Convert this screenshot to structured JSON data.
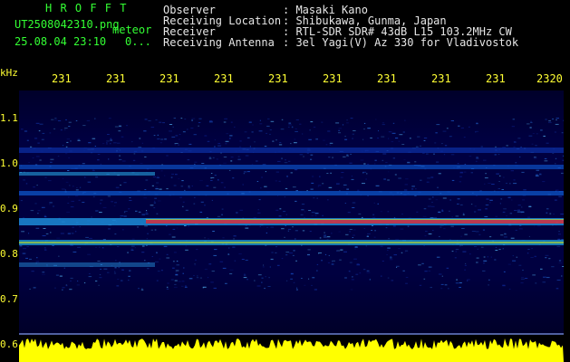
{
  "header": {
    "app_name": "H R O F F T",
    "filename": "UT2508042310.png",
    "tag": "meteor",
    "timestamp": "25.08.04 23:10",
    "count": "0..."
  },
  "info": {
    "labels": [
      "Observer",
      "Receiving Location",
      "Receiver",
      "Receiving Antenna"
    ],
    "values": [
      ": Masaki Kano",
      ": Shibukawa, Gunma, Japan",
      ": RTL-SDR SDR# 43dB L15 103.2MHz CW",
      ": 3el Yagi(V) Az 330 for Vladivostok"
    ]
  },
  "axis": {
    "y_unit": "kHz",
    "y_ticks": [
      "1.1",
      "1.0",
      "0.9",
      "0.8",
      "0.7",
      "0.6"
    ],
    "x_ticks": [
      "231",
      "231",
      "231",
      "231",
      "231",
      "231",
      "231",
      "231",
      "231",
      "2320"
    ]
  },
  "colors": {
    "background": "#000000",
    "spectrogram_base": "#00003a",
    "label_green": "#33ff33",
    "label_yellow": "#ffff33",
    "signal_red": "#ff2020",
    "signal_yellow": "#ffff00"
  }
}
